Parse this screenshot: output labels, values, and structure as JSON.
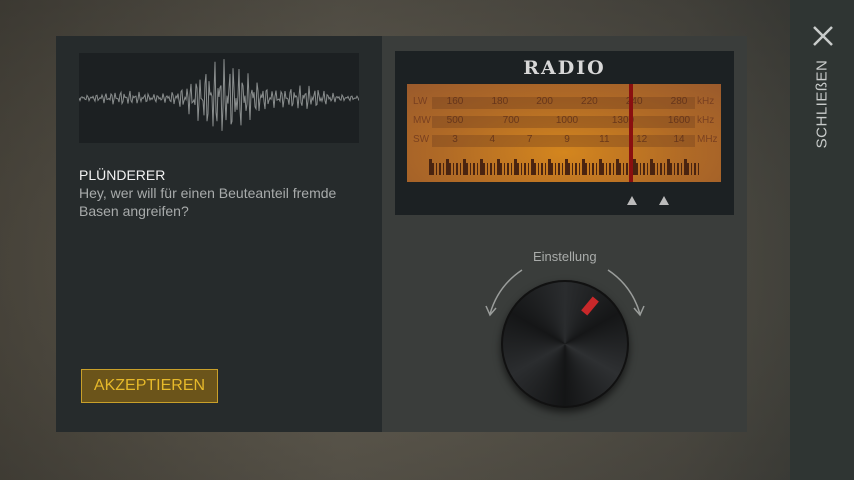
{
  "sidebar": {
    "close_label": "SCHLIEßEN",
    "close_icon": "close-icon"
  },
  "dialog": {
    "speaker": "PLÜNDERER",
    "message": "Hey, wer will für einen Beuteanteil fremde Basen angreifen?",
    "accept_label": "AKZEPTIEREN"
  },
  "radio": {
    "title": "RADIO",
    "bands": [
      {
        "name": "LW",
        "unit": "kHz",
        "values": [
          "160",
          "180",
          "200",
          "220",
          "240",
          "280"
        ]
      },
      {
        "name": "MW",
        "unit": "kHz",
        "values": [
          "500",
          "700",
          "1000",
          "1300",
          "1600"
        ]
      },
      {
        "name": "SW",
        "unit": "MHz",
        "values": [
          "3",
          "4",
          "7",
          "9",
          "11",
          "12",
          "14"
        ]
      }
    ],
    "needle_position": 0.72,
    "knob_label": "Einstellung"
  },
  "colors": {
    "accent": "#e6b92a",
    "needle": "#8a0f0f",
    "dial": "#d4861e"
  }
}
